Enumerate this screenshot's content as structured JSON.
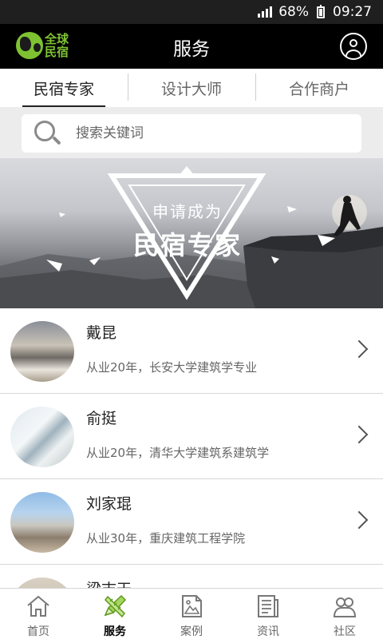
{
  "status_bar": {
    "battery_percent": "68%",
    "time": "09:27"
  },
  "header": {
    "logo_text": "全球民宿",
    "title": "服务"
  },
  "tabs": [
    {
      "label": "民宿专家",
      "active": true
    },
    {
      "label": "设计大师",
      "active": false
    },
    {
      "label": "合作商户",
      "active": false
    }
  ],
  "search": {
    "placeholder": "搜索关键词"
  },
  "banner": {
    "line1": "申请成为",
    "line2": "民宿专家"
  },
  "experts": [
    {
      "name": "戴昆",
      "description": "从业20年，长安大学建筑学专业"
    },
    {
      "name": "俞挺",
      "description": "从业20年，清华大学建筑系建筑学"
    },
    {
      "name": "刘家琨",
      "description": "从业30年，重庆建筑工程学院"
    },
    {
      "name": "梁志天",
      "description": ""
    }
  ],
  "bottom_nav": [
    {
      "label": "首页",
      "icon": "home-icon",
      "active": false
    },
    {
      "label": "服务",
      "icon": "service-icon",
      "active": true
    },
    {
      "label": "案例",
      "icon": "case-icon",
      "active": false
    },
    {
      "label": "资讯",
      "icon": "news-icon",
      "active": false
    },
    {
      "label": "社区",
      "icon": "community-icon",
      "active": false
    }
  ],
  "colors": {
    "brand_green": "#7ec232",
    "header_bg": "#000000",
    "active_nav": "#7ec232"
  }
}
